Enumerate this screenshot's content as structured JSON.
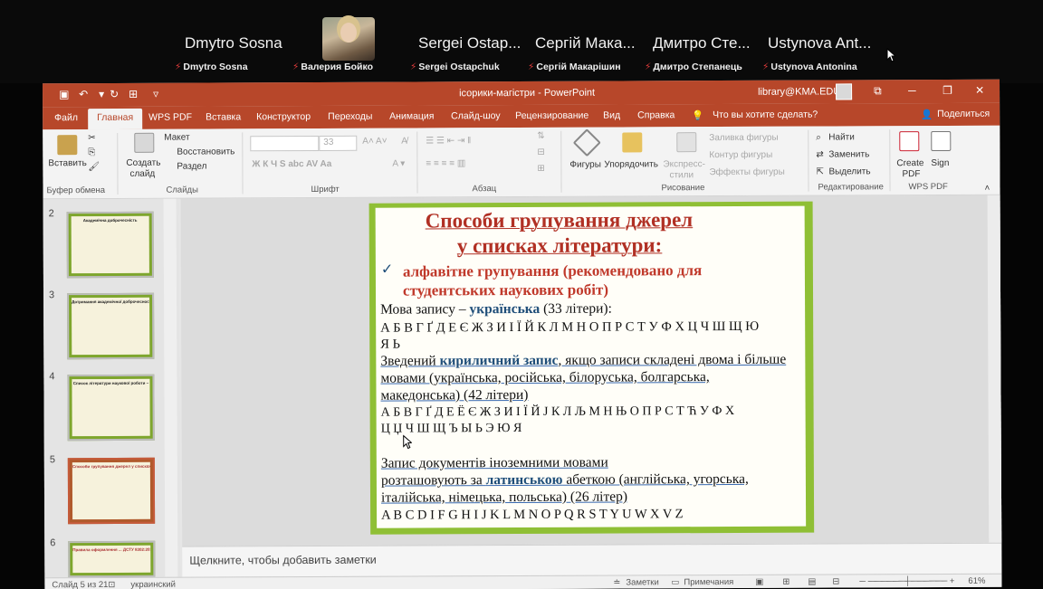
{
  "participants": {
    "big": [
      "Dmytro Sosna",
      "Sergei Ostap...",
      "Сергій Мака...",
      "Дмитро Сте...",
      "Ustynova Ant..."
    ],
    "small": [
      "Dmytro Sosna",
      "Валерия Бойко",
      "Sergei Ostapchuk",
      "Сергій Макарішин",
      "Дмитро Степанець",
      "Ustynova Antonina"
    ]
  },
  "titlebar": {
    "doc_title": "ісорики-магістри  -  PowerPoint",
    "account": "library@KMA.EDU"
  },
  "ribbon_tabs": [
    "Файл",
    "Главная",
    "WPS PDF",
    "Вставка",
    "Конструктор",
    "Переходы",
    "Анимация",
    "Слайд-шоу",
    "Рецензирование",
    "Вид",
    "Справка"
  ],
  "tell_me": "Что вы хотите сделать?",
  "share_label": "Поделиться",
  "ribbon": {
    "paste": "Вставить",
    "new_slide_1": "Создать",
    "new_slide_2": "слайд",
    "layout": "Макет",
    "reset": "Восстановить",
    "section": "Раздел",
    "font_size": "33",
    "font_buttons": "Ж  К  Ч  S  abc  AV  Aa",
    "shapes": "Фигуры",
    "arrange": "Упорядочить",
    "quick_styles_1": "Экспресс-",
    "quick_styles_2": "стили",
    "fill": "Заливка фигуры",
    "outline": "Контур фигуры",
    "effects": "Эффекты фигуры",
    "find": "Найти",
    "replace": "Заменить",
    "select": "Выделить",
    "create_pdf_1": "Create",
    "create_pdf_2": "PDF",
    "sign": "Sign",
    "groups": [
      "Буфер обмена",
      "Слайды",
      "Шрифт",
      "Абзац",
      "Рисование",
      "Редактирование",
      "WPS PDF"
    ]
  },
  "thumbs": {
    "numbers": [
      "2",
      "3",
      "4",
      "5",
      "6"
    ],
    "titles": [
      "Академічна доброчесність",
      "Дотримання академічної доброчесності",
      "Список літератури наукової роботи –",
      "Способи групування джерел у списках літератури:",
      "Правила оформлення ... ДСТУ 8302:2015"
    ]
  },
  "slide": {
    "title_1": "Способи групування  джерел",
    "title_2": "у списках літератури:",
    "check": "✓",
    "alpha_1": "алфавітне групування (рекомендовано для",
    "alpha_2": "студентських наукових робіт)",
    "ukr_pre": "Мова запису – ",
    "ukr_word": "українська",
    "ukr_post": " (33 літери):",
    "ukr_letters_1": "А Б В Г Ґ Д Е Є Ж З И І Ї Й К Л М Н О П Р С Т У Ф Х Ц Ч Ш Щ Ю",
    "ukr_letters_2": "Я Ь",
    "cyr_1a": "Зведений ",
    "cyr_1b": "кириличний запис",
    "cyr_1c": ", якщо записи складені двома і більше",
    "cyr_2": "мовами (українська, російська, білоруська, болгарська,",
    "cyr_3": "македонська) (42 літери)",
    "cyr_letters_1": "А Б В Г Ґ Д Е Ё Є Ж З И І Ї Й J К Л Љ М Н Њ О П Р С Т Ћ У Ф Х",
    "cyr_letters_2": "Ц Џ Ч Ш Щ Ъ Ы Ь Э Ю Я",
    "lat_1": "Запис документів іноземними мовами",
    "lat_2a": "розташовують за ",
    "lat_2b": "латинською",
    "lat_2c": " абеткою (англійська, угорська,",
    "lat_3": "італійська, німецька, польська) (26 літер)",
    "lat_letters": "A B C D I F G H I J K L M N O P Q R S T Y U W X V Z"
  },
  "notes_placeholder": "Щелкните, чтобы добавить заметки",
  "status": {
    "slide_of": "Слайд 5 из 21",
    "language": "украинский",
    "notes": "Заметки",
    "comments": "Примечания",
    "zoom": "61%"
  },
  "colors": {
    "accent": "#b7472a",
    "slide_border": "#8fbf35",
    "slide_title": "#b13024",
    "slide_blue": "#1f4e79"
  }
}
